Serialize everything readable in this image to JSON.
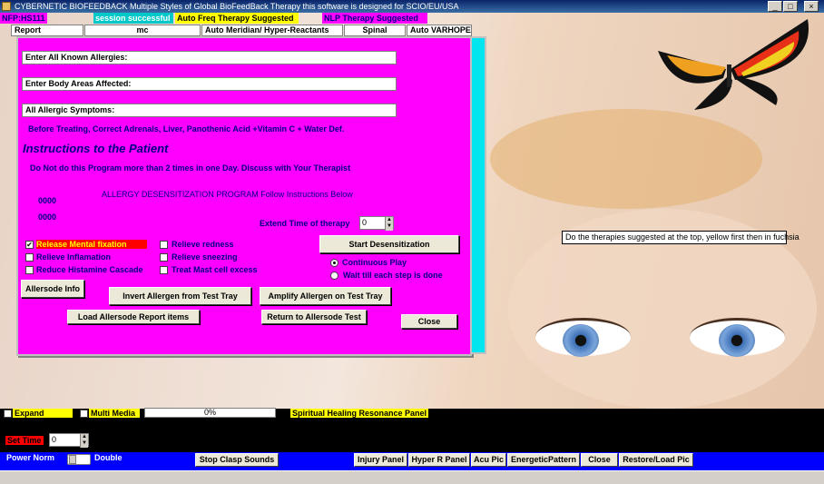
{
  "window": {
    "title": "CYBERNETIC BIOFEEDBACK  Multiple Styles of Global BioFeedBack Therapy  this software is designed for SCIO/EU/USA"
  },
  "top": {
    "nfp_label": "NFP:HS111",
    "session_label": "session successful",
    "auto_freq": "Auto Freq Therapy Suggested",
    "nlp": "NLP Therapy Suggested",
    "tabs": [
      "Report",
      "mc",
      "Auto Meridian/ Hyper-Reactants",
      "Spinal",
      "Auto VARHOPE"
    ]
  },
  "dialog": {
    "allergies_field": "Enter All Known Allergies:",
    "body_areas_field": "Enter Body Areas Affected:",
    "symptoms_field": "All Allergic Symptoms:",
    "before_treating": "Before Treating, Correct Adrenals, Liver, Panothenic Acid +Vitamin C + Water Def.",
    "instructions_heading": "Instructions to the Patient",
    "instructions_text": "Do Not do this Program more than 2 times in one Day. Discuss with Your Therapist",
    "counter1": "0000",
    "counter2": "0000",
    "program_title": "ALLERGY DESENSITIZATION PROGRAM  Follow Instructions Below",
    "extend_label": "Extend Time of therapy",
    "extend_value": "0",
    "checkboxes": [
      {
        "label": "Release Mental fixation",
        "checked": true
      },
      {
        "label": "Relieve Inflamation",
        "checked": false
      },
      {
        "label": "Reduce Histamine Cascade",
        "checked": false
      },
      {
        "label": "Relieve redness",
        "checked": false
      },
      {
        "label": "Relieve sneezing",
        "checked": false
      },
      {
        "label": "Treat Mast cell excess",
        "checked": false
      }
    ],
    "start_button": "Start Desensitization",
    "radio_continuous": "Continuous Play",
    "radio_wait": "Wait till each step is done",
    "allersode_info": "Allersode Info",
    "invert_button": "Invert Allergen from Test  Tray",
    "amplify_button": "Amplify Allergen on Test Tray",
    "load_report_button": "Load Allersode Report items",
    "return_button": "Return to Allersode Test",
    "close_button": "Close"
  },
  "tooltip": "Do the therapies suggested at the top, yellow first then in fuchsia",
  "bottom": {
    "expand_label": "Expand",
    "multimedia_label": "Multi Media",
    "progress_text": "0%",
    "progress_value": 0,
    "spiritual_label": "Spiritual Healing Resonance Panel",
    "set_time_label": "Set Time",
    "set_time_value": "0",
    "power_label": "Power  Norm",
    "double_label": "Double",
    "stop_clasp": "Stop Clasp Sounds",
    "right_buttons": [
      "Injury Panel",
      "Hyper R Panel",
      "Acu Pic",
      "EnergeticPattern",
      "Close",
      "Restore/Load Pic"
    ]
  },
  "colors": {
    "dialog_bg": "#ff00ff",
    "cyan_bar": "#00e5ee",
    "yellow_tag": "#ffff00",
    "blue_bar": "#0000ff"
  },
  "icons": [
    "app-icon",
    "minimize-icon",
    "maximize-icon",
    "close-icon",
    "butterfly-icon",
    "check-icon",
    "spin-up-icon",
    "spin-down-icon"
  ]
}
